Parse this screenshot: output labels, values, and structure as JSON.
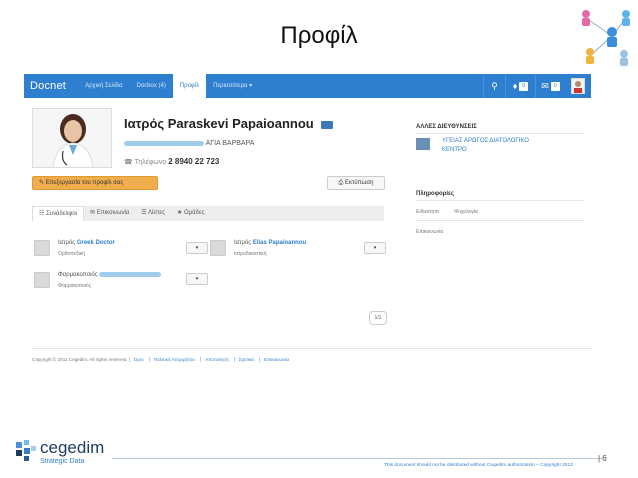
{
  "slide": {
    "title": "Προφίλ",
    "page_number": "| 6",
    "disclaimer": "This document should not be distributed without Cegedim authorization – Copyright 2013"
  },
  "logo": {
    "name": "cegedim",
    "subtitle": "Strategic Data"
  },
  "navbar": {
    "brand": "Docnet",
    "items": [
      "Αρχική Σελίδα",
      "Docbox (4)",
      "Προφίλ",
      "Περισσότερα ▾"
    ],
    "active_index": 2,
    "icons": [
      "search-icon",
      "bell-icon",
      "envelope-icon"
    ],
    "notification_count": "0",
    "message_count": "0"
  },
  "profile": {
    "name": "Ιατρός Paraskevi Papaioannou",
    "address_suffix": "ΑΓΙΑ ΒΑΡΒΑΡΑ",
    "phone_label": "Τηλέφωνο",
    "phone": "2 8940 22 723",
    "edit_label": "Επεξεργασία του προφίλ σας",
    "print_label": "Εκτύπωση"
  },
  "tabs": [
    {
      "label": "Συνάδελφοι",
      "icon": "people-icon"
    },
    {
      "label": "Επικοινωνία",
      "icon": "chat-icon"
    },
    {
      "label": "Λίστες",
      "icon": "list-icon"
    },
    {
      "label": "Ομάδες",
      "icon": "groups-icon"
    }
  ],
  "contacts": [
    {
      "title": "Ιατρός",
      "name": "Greek Doctor",
      "specialty": "Ορθοπεδική"
    },
    {
      "title": "Ιατρός",
      "name": "Elias Papaioannou",
      "specialty": "Ιατροδικαστική"
    },
    {
      "title": "Φαρμακοποιός",
      "name": "",
      "specialty": "Φαρμακοποιός"
    }
  ],
  "pagination": "1/1",
  "sidebar": {
    "other_addresses_title": "ΑΛΛΕΣ ΔΙΕΥΘΥΝΣΕΙΣ",
    "other_address_line1": "ΥΓΕΙΑΣ ΑΡΩΓΟΣ ΔΙΑΤΟΛΟΓΙΚΟ",
    "other_address_line2": "ΚΕΝΤΡΟ",
    "info_title": "Πληροφορίες",
    "specialty_label": "Ειδικότητα",
    "specialty_value": "Ψυχολογία",
    "contact_label": "Επικοινωνία"
  },
  "footer": {
    "copyright": "Copyright © 2011 Cegedim. All rights reserved.",
    "links": [
      "Όροι",
      "Πολιτική Απορρήτου",
      "Αποποίηση",
      "Σχετικά",
      "Επικοινωνία"
    ]
  }
}
